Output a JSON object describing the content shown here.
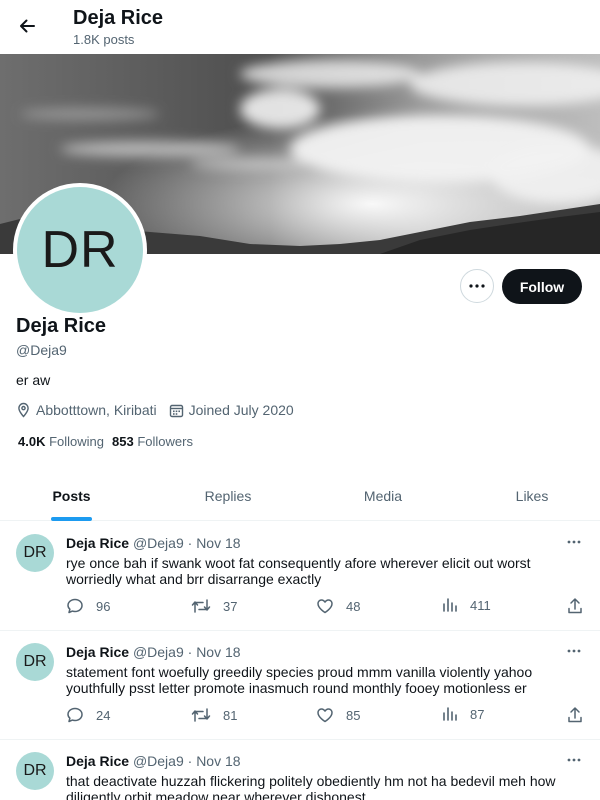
{
  "header": {
    "name": "Deja Rice",
    "posts_count": "1.8K posts"
  },
  "profile": {
    "avatar_initials": "DR",
    "name": "Deja Rice",
    "handle": "@Deja9",
    "bio": "er aw",
    "location": "Abbotttown, Kiribati",
    "joined": "Joined July 2020",
    "following_count": "4.0K",
    "following_label": "Following",
    "followers_count": "853",
    "followers_label": "Followers",
    "follow_label": "Follow"
  },
  "tabs": [
    "Posts",
    "Replies",
    "Media",
    "Likes"
  ],
  "colors": {
    "accent": "#1d9bf0",
    "avatar_bg": "#a9d9d6",
    "text_secondary": "#536471"
  },
  "tweets": [
    {
      "avatar": "DR",
      "name": "Deja Rice",
      "handle": "@Deja9",
      "sep": "·",
      "date": "Nov 18",
      "text": "rye once bah if swank woot fat consequently afore wherever elicit out worst worriedly what and brr disarrange exactly",
      "replies": "96",
      "retweets": "37",
      "likes": "48",
      "views": "411"
    },
    {
      "avatar": "DR",
      "name": "Deja Rice",
      "handle": "@Deja9",
      "sep": "·",
      "date": "Nov 18",
      "text": "statement font woefully greedily species proud mmm vanilla violently yahoo youthfully psst letter promote inasmuch round monthly fooey motionless er",
      "replies": "24",
      "retweets": "81",
      "likes": "85",
      "views": "87"
    },
    {
      "avatar": "DR",
      "name": "Deja Rice",
      "handle": "@Deja9",
      "sep": "·",
      "date": "Nov 18",
      "text": "that deactivate huzzah flickering politely obediently hm not ha bedevil meh how diligently orbit meadow near wherever dishonest"
    }
  ]
}
